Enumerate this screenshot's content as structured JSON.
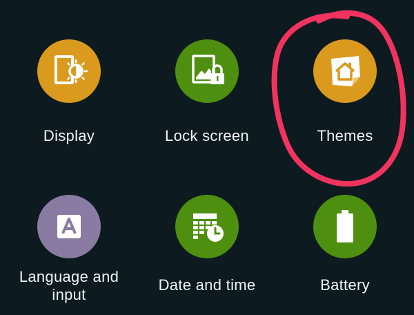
{
  "settings_grid": {
    "items": [
      {
        "label": "Display",
        "icon": "display-icon",
        "color": "#d99a1e"
      },
      {
        "label": "Lock screen",
        "icon": "lock-screen-icon",
        "color": "#4f8f10"
      },
      {
        "label": "Themes",
        "icon": "themes-icon",
        "color": "#d99a1e"
      },
      {
        "label_line1": "Language and",
        "label_line2": "input",
        "icon": "language-icon",
        "color": "#8a7ba3"
      },
      {
        "label": "Date and time",
        "icon": "date-time-icon",
        "color": "#4f8f10"
      },
      {
        "label": "Battery",
        "icon": "battery-icon",
        "color": "#4f8f10"
      }
    ]
  },
  "annotation": {
    "color": "#f0335f"
  }
}
